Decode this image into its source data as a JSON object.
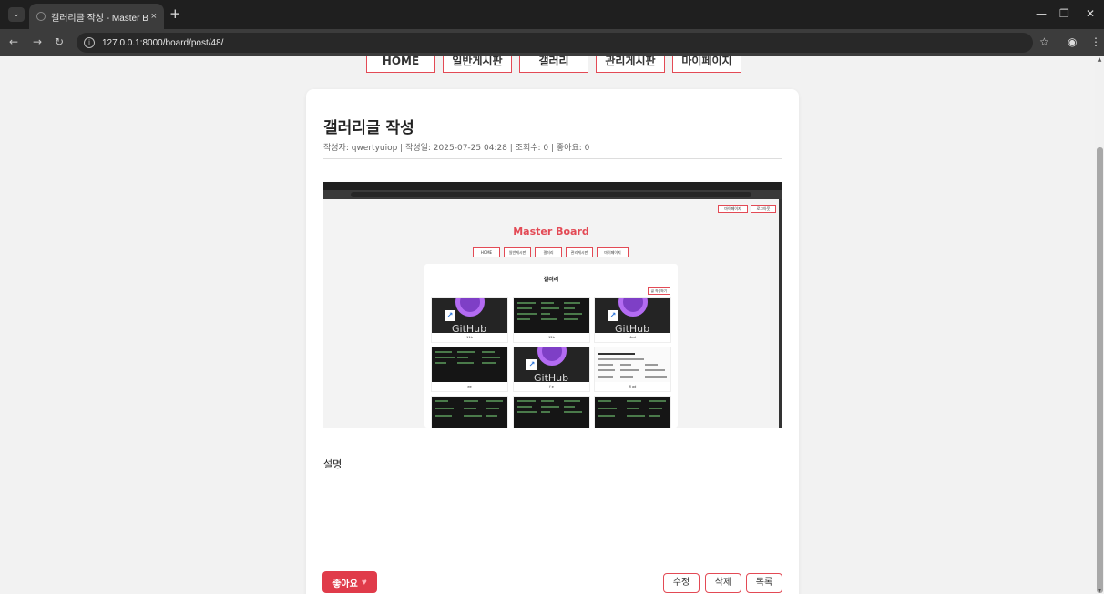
{
  "browser": {
    "tab_title": "갤러리글 작성 - Master Board",
    "tab_close": "×",
    "new_tab": "+",
    "url": "127.0.0.1:8000/board/post/48/",
    "back_icon": "arrow-left-icon",
    "forward_icon": "arrow-right-icon",
    "reload_icon": "reload-icon"
  },
  "nav": {
    "home": "HOME",
    "general_board": "일반게시판",
    "gallery": "갤러리",
    "admin_board": "관리게시판",
    "mypage": "마이페이지"
  },
  "post": {
    "title": "갤러리글 작성",
    "meta": "작성자: qwertyuiop | 작성일: 2025-07-25 04:28 | 조회수: 0 | 좋아요: 0",
    "description_label": "설명"
  },
  "embedded_screenshot": {
    "brand": "Master Board",
    "top_btn_mypage": "마이페이지",
    "top_btn_logout": "로그아웃",
    "nav": [
      "HOME",
      "일반게시판",
      "갤러리",
      "관리게시판",
      "마이페이지"
    ],
    "gallery_title": "갤러리",
    "write_button": "글 작성하기",
    "captions": [
      "11b",
      "12b",
      "4ad",
      "ee",
      "f e",
      "fl ad"
    ]
  },
  "actions": {
    "like": "좋아요",
    "edit": "수정",
    "delete": "삭제",
    "list": "목록"
  },
  "colors": {
    "accent": "#e34a55",
    "like_button": "#e03b4a"
  }
}
